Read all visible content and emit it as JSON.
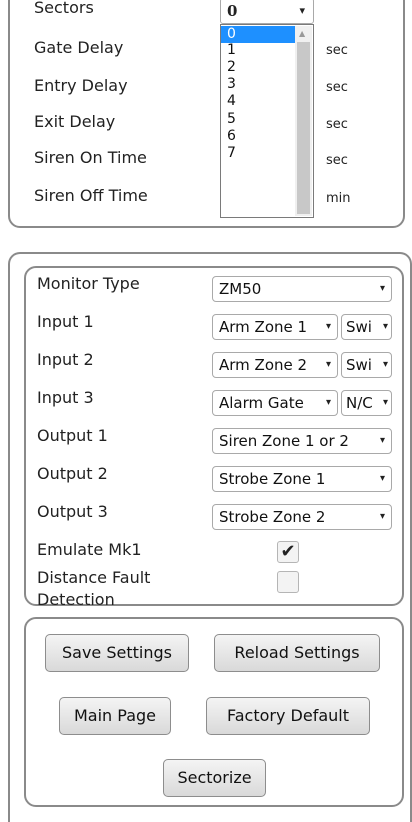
{
  "top_panel": {
    "sectors_label": "Sectors",
    "sectors_value": "0",
    "sector_options": [
      "0",
      "1",
      "2",
      "3",
      "4",
      "5",
      "6",
      "7"
    ],
    "rows": [
      {
        "label": "Gate Delay",
        "unit": "sec"
      },
      {
        "label": "Entry Delay",
        "unit": "sec"
      },
      {
        "label": "Exit Delay",
        "unit": "sec"
      },
      {
        "label": "Siren On Time",
        "unit": "sec"
      },
      {
        "label": "Siren Off Time",
        "unit": "min"
      }
    ]
  },
  "monitor_panel": {
    "monitor_type": {
      "label": "Monitor Type",
      "value": "ZM50"
    },
    "input1": {
      "label": "Input 1",
      "value": "Arm Zone 1",
      "mode": "Swi"
    },
    "input2": {
      "label": "Input 2",
      "value": "Arm Zone 2",
      "mode": "Swi"
    },
    "input3": {
      "label": "Input 3",
      "value": "Alarm Gate",
      "mode": "N/C"
    },
    "output1": {
      "label": "Output 1",
      "value": "Siren Zone 1 or 2"
    },
    "output2": {
      "label": "Output 2",
      "value": "Strobe Zone 1"
    },
    "output3": {
      "label": "Output 3",
      "value": "Strobe Zone 2"
    },
    "emulate": {
      "label": "Emulate Mk1",
      "checked": true
    },
    "distance_fault": {
      "label_line1": "Distance Fault",
      "label_line2": "Detection",
      "checked": false
    }
  },
  "buttons": {
    "save": "Save Settings",
    "reload": "Reload Settings",
    "main": "Main Page",
    "factory": "Factory Default",
    "sectorize": "Sectorize"
  },
  "icons": {
    "dropdown_arrow": "▾",
    "checkmark": "✔"
  }
}
